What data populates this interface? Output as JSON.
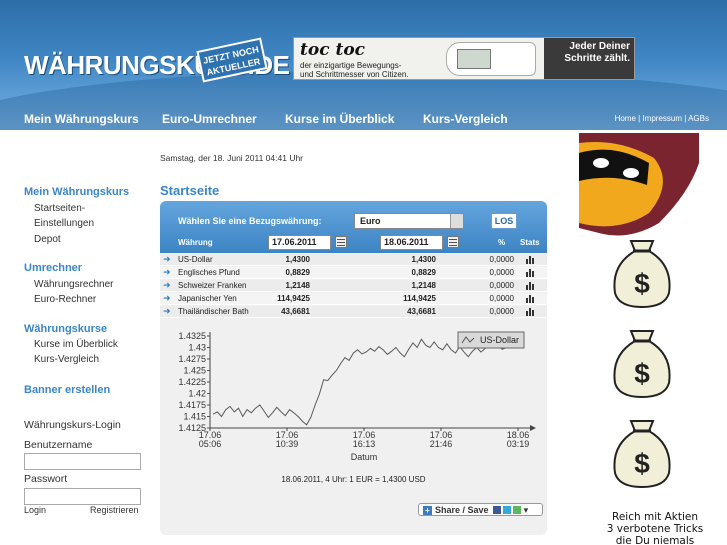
{
  "header": {
    "logo": "WÄHRUNGSKURS.DE",
    "badge": "JETZT NOCH AKTUELLER",
    "ad": {
      "brand": "toc toc",
      "line1": "der einzigartige Bewegungs-",
      "line2": "und Schrittmesser von Citizen.",
      "tagline1": "Jeder Deiner",
      "tagline2": "Schritte zählt."
    }
  },
  "nav": {
    "items": [
      "Mein Währungskurs",
      "Euro-Umrechner",
      "Kurse im Überblick",
      "Kurs-Vergleich"
    ],
    "utility": [
      "Home",
      "Impressum",
      "AGBs"
    ]
  },
  "sidebar": {
    "section1": {
      "title": "Mein Währungskurs",
      "links": [
        "Startseiten-",
        "Einstellungen",
        "Depot"
      ]
    },
    "section2": {
      "title": "Umrechner",
      "links": [
        "Währungsrechner",
        "Euro-Rechner"
      ]
    },
    "section3": {
      "title": "Währungskurse",
      "links": [
        "Kurse im Überblick",
        "Kurs-Vergleich"
      ]
    },
    "banner": "Banner erstellen",
    "login": {
      "title": "Währungskurs-Login",
      "user_label": "Benutzername",
      "pass_label": "Passwort",
      "login_link": "Login",
      "register_link": "Registrieren"
    }
  },
  "main": {
    "datetime": "Samstag, der 18. Juni 2011 04:41 Uhr",
    "title": "Startseite",
    "reference_label": "Wählen Sie eine Bezugswährung:",
    "reference_value": "Euro",
    "go_button": "LOS",
    "columns": {
      "currency": "Währung",
      "date1": "17.06.2011",
      "date2": "18.06.2011",
      "percent": "%",
      "stats": "Stats"
    },
    "rows": [
      {
        "name": "US-Dollar",
        "v1": "1,4300",
        "v2": "1,4300",
        "pct": "0,0000"
      },
      {
        "name": "Englisches Pfund",
        "v1": "0,8829",
        "v2": "0,8829",
        "pct": "0,0000"
      },
      {
        "name": "Schweizer Franken",
        "v1": "1,2148",
        "v2": "1,2148",
        "pct": "0,0000"
      },
      {
        "name": "Japanischer Yen",
        "v1": "114,9425",
        "v2": "114,9425",
        "pct": "0,0000"
      },
      {
        "name": "Thailändischer Bath",
        "v1": "43,6681",
        "v2": "43,6681",
        "pct": "0,0000"
      }
    ],
    "footer": "18.06.2011, 4 Uhr: 1 EUR = 1,4300 USD",
    "share_label": "Share / Save"
  },
  "chart_data": {
    "type": "line",
    "xlabel": "Datum",
    "ylim": [
      1.4125,
      1.4325
    ],
    "yticks": [
      "1.4325",
      "1.43",
      "1.4275",
      "1.425",
      "1.4225",
      "1.42",
      "1.4175",
      "1.415",
      "1.4125"
    ],
    "xticks": [
      {
        "d": "17.06",
        "t": "05:06"
      },
      {
        "d": "17.06",
        "t": "10:39"
      },
      {
        "d": "17.06",
        "t": "16:13"
      },
      {
        "d": "17.06",
        "t": "21:46"
      },
      {
        "d": "18.06",
        "t": "03:19"
      }
    ],
    "series": [
      {
        "name": "US-Dollar",
        "values": [
          1.4155,
          1.416,
          1.415,
          1.4165,
          1.4172,
          1.416,
          1.4168,
          1.415,
          1.4165,
          1.4158,
          1.4168,
          1.4175,
          1.4162,
          1.4148,
          1.4158,
          1.417,
          1.416,
          1.4152,
          1.4165,
          1.4158,
          1.415,
          1.414,
          1.4132,
          1.4148,
          1.4175,
          1.4198,
          1.423,
          1.4228,
          1.424,
          1.425,
          1.4265,
          1.4278,
          1.4272,
          1.4288,
          1.4295,
          1.4286,
          1.429,
          1.4298,
          1.4292,
          1.4302,
          1.4295,
          1.4285,
          1.4292,
          1.43,
          1.4288,
          1.428,
          1.4296,
          1.431,
          1.43,
          1.4318,
          1.4305,
          1.43,
          1.4312,
          1.43,
          1.4295,
          1.4308,
          1.4295,
          1.4288,
          1.4302,
          1.429,
          1.428,
          1.4292,
          1.43,
          1.429,
          1.4298,
          1.4308,
          1.43,
          1.4304,
          1.4296,
          1.43,
          1.43,
          1.43
        ]
      }
    ]
  },
  "right_ad": {
    "caption": [
      "Reich mit Aktien",
      "3 verbotene Tricks",
      "die Du niemals"
    ]
  },
  "colors": {
    "accent": "#3a86c8",
    "header_blue": "#3f86c4",
    "line": "#5a5a5a"
  }
}
